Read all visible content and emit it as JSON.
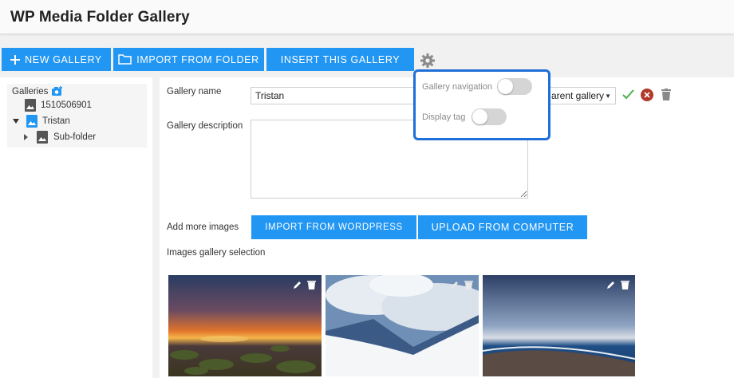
{
  "app": {
    "title": "WP Media Folder Gallery"
  },
  "toolbar": {
    "new_gallery": "NEW GALLERY",
    "import_folder": "IMPORT FROM FOLDER",
    "insert_gallery": "INSERT THIS GALLERY"
  },
  "sidebar": {
    "root_label": "Galleries",
    "items": [
      {
        "label": "1510506901"
      },
      {
        "label": "Tristan"
      },
      {
        "label": "Sub-folder"
      }
    ]
  },
  "form": {
    "name_label": "Gallery name",
    "name_value": "Tristan",
    "parent_select": "arent gallery",
    "description_label": "Gallery description",
    "add_images_label": "Add more images",
    "import_wp": "IMPORT FROM WORDPRESS",
    "upload_computer": "UPLOAD FROM COMPUTER",
    "selection_label": "Images gallery selection"
  },
  "settings_popup": {
    "navigation_label": "Gallery navigation",
    "navigation_on": false,
    "display_tag_label": "Display tag",
    "display_tag_on": false
  },
  "colors": {
    "accent": "#2196f3",
    "popup_border": "#1f6fd8",
    "check": "#4caf50",
    "delete": "#b23a2a"
  }
}
